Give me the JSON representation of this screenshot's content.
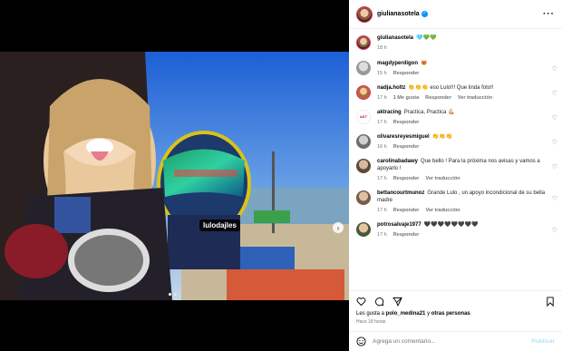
{
  "post": {
    "author": "giulianasotela",
    "more_icon": "ellipsis-icon",
    "tag_label": "lulodajles",
    "caption": {
      "user": "giulianasotela",
      "text": "🩵💚💚",
      "time": "18 h"
    }
  },
  "comments": [
    {
      "user": "magdyperdigon",
      "text": "😻",
      "time": "15 h",
      "reply": "Responder"
    },
    {
      "user": "nadja.holtz",
      "text": "👏👏👏 eso Lulo!!! Que linda foto!!",
      "time": "17 h",
      "likes": "1 Me gusta",
      "reply": "Responder",
      "translate": "Ver traducción"
    },
    {
      "user": "aktracing",
      "text": "Practica, Practica 💪🏼",
      "time": "17 h",
      "reply": "Responder"
    },
    {
      "user": "olivaresreyesmiguel",
      "text": "👏👏👏",
      "time": "16 h",
      "reply": "Responder"
    },
    {
      "user": "carolinabadawy",
      "text": "Que bello ! Para la próxima nos avisas y vamos a apoyarlo !",
      "time": "17 h",
      "reply": "Responder",
      "translate": "Ver traducción"
    },
    {
      "user": "bettancourtmunoz",
      "text": "Grande Lulo , un apoyo incondicional de su bella madre",
      "time": "17 h",
      "reply": "Responder",
      "translate": "Ver traducción"
    },
    {
      "user": "potrosalvaje1977",
      "text": "🖤🖤🖤🖤🖤🖤🖤🖤",
      "time": "17 h",
      "reply": "Responder"
    }
  ],
  "actions": {
    "likes_prefix": "Les gusta a",
    "likes_user": "polo_medina21",
    "likes_mid": "y",
    "likes_others": "otras personas",
    "ago": "Hace 18 horas"
  },
  "add_comment": {
    "placeholder": "Agrega un comentario...",
    "publish": "Publicar"
  },
  "colors": {
    "accent": "#0095f6",
    "publish": "#b2dffc",
    "meta": "#737373"
  }
}
